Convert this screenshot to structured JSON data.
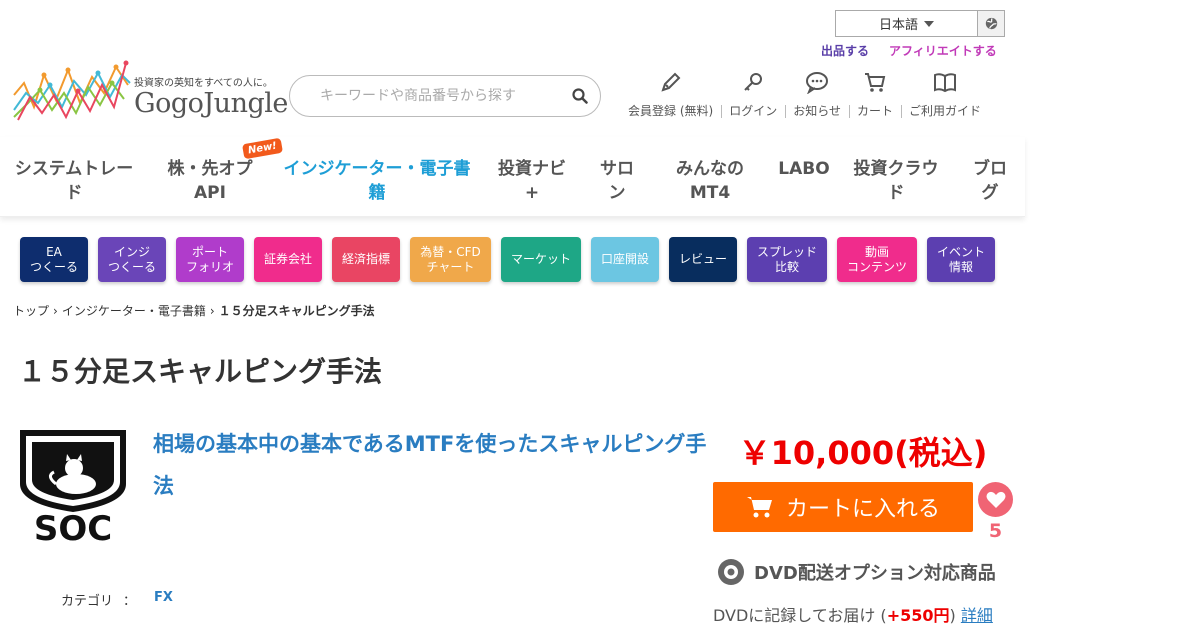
{
  "header": {
    "language": "日本語",
    "links": {
      "sell": "出品する",
      "affiliate": "アフィリエイトする"
    },
    "logo_tagline": "投資家の英知をすべての人に。",
    "logo_name": "GogoJungle",
    "search_placeholder": "キーワードや商品番号から探す",
    "user_icons": [
      {
        "label": "会員登録 (無料)",
        "icon": "pencil-icon"
      },
      {
        "label": "ログイン",
        "icon": "key-icon"
      },
      {
        "label": "お知らせ",
        "icon": "chat-icon"
      },
      {
        "label": "カート",
        "icon": "cart-icon"
      },
      {
        "label": "ご利用ガイド",
        "icon": "book-icon"
      }
    ]
  },
  "nav": {
    "items": [
      {
        "label": "システムトレード"
      },
      {
        "label": "株・先オプAPI"
      },
      {
        "label": "インジケーター・電子書籍"
      },
      {
        "label": "投資ナビ+"
      },
      {
        "label": "サロン"
      },
      {
        "label": "みんなのMT4"
      },
      {
        "label": "LABO"
      },
      {
        "label": "投資クラウド"
      },
      {
        "label": "ブログ"
      }
    ],
    "new_badge": "New!"
  },
  "category_pills": [
    {
      "label": "EA\nつくーる",
      "color": "#0e2d6e"
    },
    {
      "label": "インジ\nつくーる",
      "color": "#6a45b8"
    },
    {
      "label": "ポート\nフォリオ",
      "color": "#b03ccb"
    },
    {
      "label": "証券会社",
      "color": "#f02c8c"
    },
    {
      "label": "経済指標",
      "color": "#e94563"
    },
    {
      "label": "為替・CFD\nチャート",
      "color": "#f0a84a"
    },
    {
      "label": "マーケット",
      "color": "#1ea786"
    },
    {
      "label": "口座開設",
      "color": "#6cc6e2"
    },
    {
      "label": "レビュー",
      "color": "#082d5e"
    },
    {
      "label": "スプレッド\n比較",
      "color": "#5c3fb0"
    },
    {
      "label": "動画\nコンテンツ",
      "color": "#f02c8c"
    },
    {
      "label": "イベント\n情報",
      "color": "#5c3fb0"
    }
  ],
  "breadcrumb": {
    "top": "トップ",
    "category": "インジケーター・電子書籍",
    "current": "１５分足スキャルピング手法"
  },
  "product": {
    "title": "１５分足スキャルピング手法",
    "tagline": "相場の基本中の基本であるMTFを使ったスキャルピング手法",
    "logo_text": "SOC",
    "price": "￥10,000(税込)",
    "cart_label": "カートに入れる",
    "favorite_count": "5",
    "dvd_label": "DVD配送オプション対応商品",
    "dvd_note_prefix": "DVDに記録してお届け (",
    "dvd_note_price": "+550円",
    "dvd_note_suffix": ")",
    "dvd_detail_link": "詳細",
    "category_label": "カテゴリ",
    "category_sep": "：",
    "category_value": "FX"
  },
  "colors": {
    "accent": "#1e9ed6",
    "price": "#e00000",
    "cart": "#ff6a00",
    "favorite": "#f06474"
  }
}
